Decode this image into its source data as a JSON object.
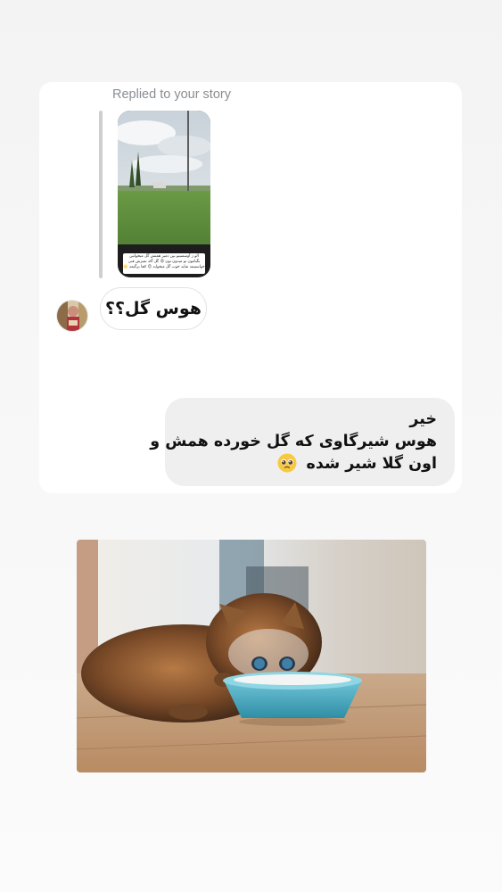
{
  "reply": {
    "caption": "Replied to your story",
    "story_caption": "الو ژ آوسمنیتو بین دمیر همتش گل میخواتین\nبگیامون تو میدون تون 😡 گل آکه تمیزش فنی خواستیمه شاید\nخوب گل میخواید 😊 کجا برگیمه 🌝"
  },
  "messages": {
    "incoming_text": "هوس گل؟؟",
    "outgoing_lines": [
      "خیر",
      "هوس شیرگاوی که گل خورده همش و",
      "اون گلا شیر شده"
    ],
    "outgoing_emoji": "pleading-face"
  },
  "photo": {
    "subject": "kitten-drinking-milk"
  }
}
